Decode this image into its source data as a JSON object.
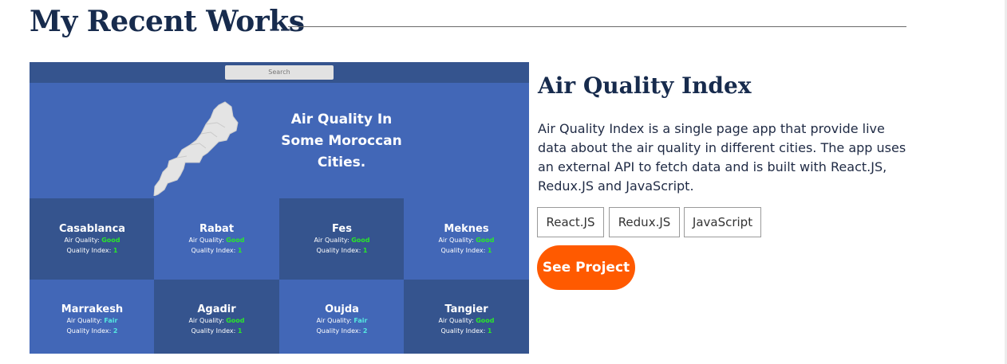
{
  "section": {
    "title": "My Recent Works"
  },
  "preview": {
    "search_placeholder": "Search",
    "hero_title": "Air Quality In Some Moroccan Cities.",
    "quality_label": "Air Quality:",
    "index_label": "Quality Index:",
    "cities": [
      {
        "name": "Casablanca",
        "quality": "Good",
        "index": "1"
      },
      {
        "name": "Rabat",
        "quality": "Good",
        "index": "1"
      },
      {
        "name": "Fes",
        "quality": "Good",
        "index": "1"
      },
      {
        "name": "Meknes",
        "quality": "Good",
        "index": "1"
      },
      {
        "name": "Marrakesh",
        "quality": "Fair",
        "index": "2"
      },
      {
        "name": "Agadir",
        "quality": "Good",
        "index": "1"
      },
      {
        "name": "Oujda",
        "quality": "Fair",
        "index": "2"
      },
      {
        "name": "Tangier",
        "quality": "Good",
        "index": "1"
      }
    ],
    "colors": {
      "dark_tile": "#35548e",
      "light_tile": "#4267b7",
      "good": "#2ae62a",
      "fair": "#55e8e0"
    }
  },
  "project": {
    "title": "Air Quality Index",
    "description": "Air Quality Index is a single page app that provide live data about the air quality in different cities. The app uses an external API to fetch data and is built with React.JS, Redux.JS and JavaScript.",
    "tags": [
      "React.JS",
      "Redux.JS",
      "JavaScript"
    ],
    "cta_label": "See Project",
    "accent_color": "#ff5a00"
  }
}
